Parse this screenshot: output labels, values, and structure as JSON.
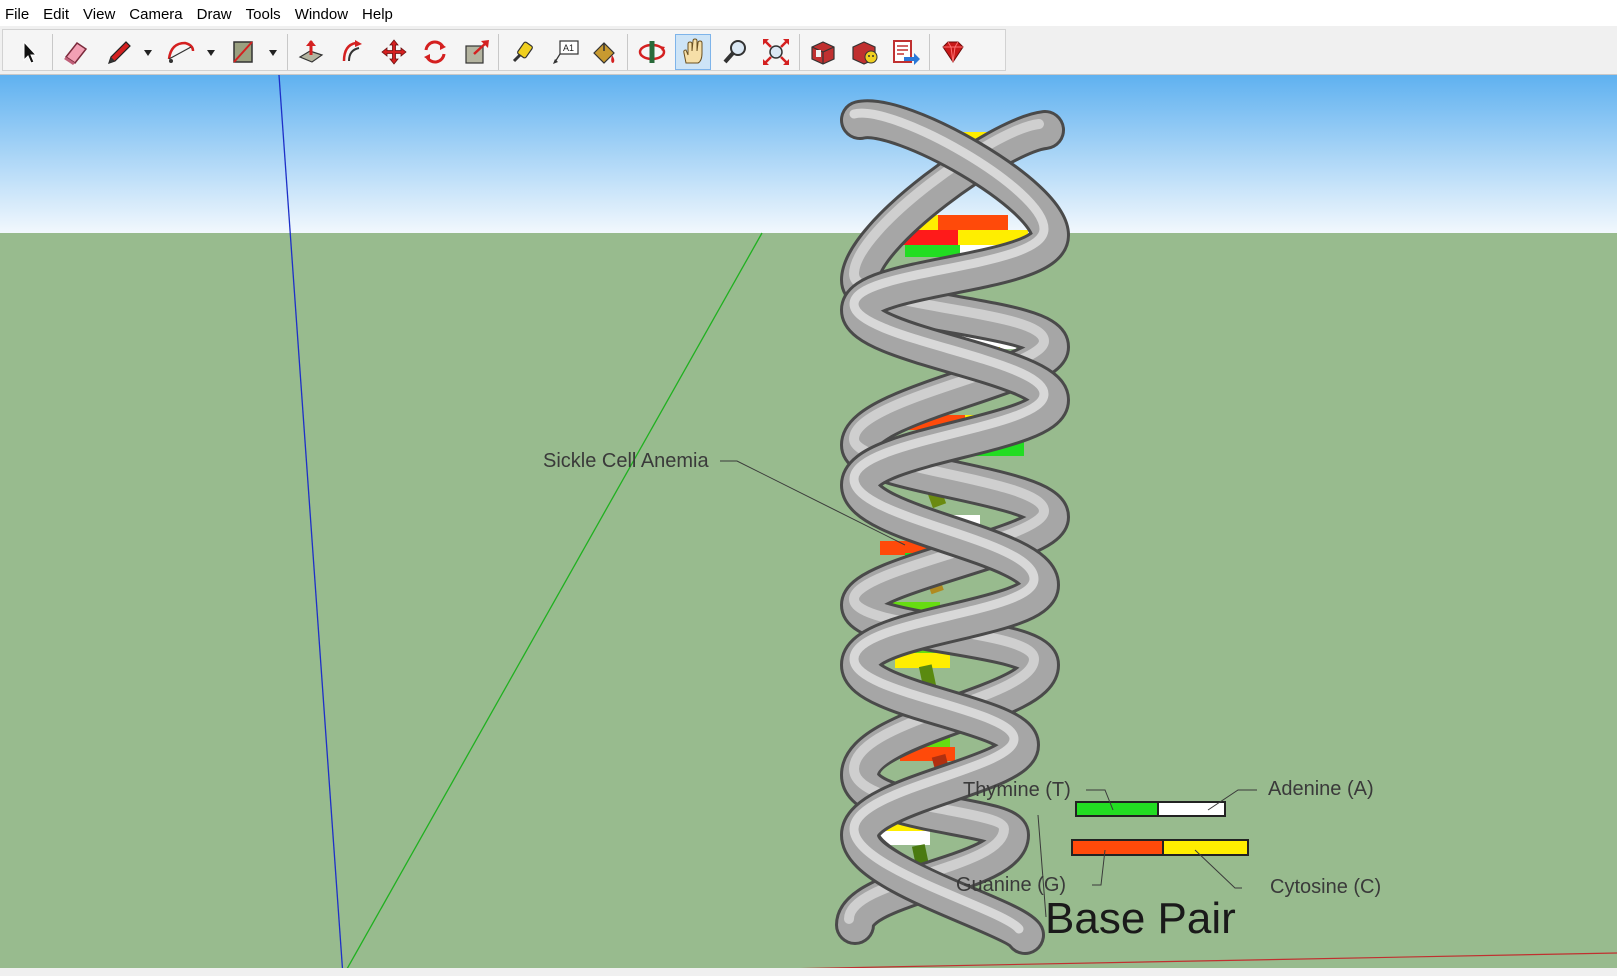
{
  "app": {
    "name": "SketchUp"
  },
  "menu": [
    "File",
    "Edit",
    "View",
    "Camera",
    "Draw",
    "Tools",
    "Window",
    "Help"
  ],
  "toolbar": {
    "tools": [
      {
        "name": "select-tool",
        "icon": "arrow-cursor-icon"
      },
      {
        "name": "eraser-tool",
        "icon": "eraser-icon"
      },
      {
        "name": "line-tool",
        "icon": "pencil-icon"
      },
      {
        "name": "arc-tool",
        "icon": "arc-icon"
      },
      {
        "name": "rectangle-tool",
        "icon": "rectangle-icon"
      },
      {
        "name": "push-pull-tool",
        "icon": "push-pull-icon"
      },
      {
        "name": "offset-tool",
        "icon": "offset-icon"
      },
      {
        "name": "move-tool",
        "icon": "move-icon"
      },
      {
        "name": "rotate-tool",
        "icon": "rotate-icon"
      },
      {
        "name": "scale-tool",
        "icon": "scale-icon"
      },
      {
        "name": "tape-measure-tool",
        "icon": "tape-measure-icon"
      },
      {
        "name": "text-tool",
        "icon": "text-label-icon"
      },
      {
        "name": "paint-bucket-tool",
        "icon": "paint-bucket-icon"
      },
      {
        "name": "orbit-tool",
        "icon": "orbit-icon"
      },
      {
        "name": "pan-tool",
        "icon": "hand-icon"
      },
      {
        "name": "zoom-tool",
        "icon": "magnifier-icon"
      },
      {
        "name": "zoom-extents-tool",
        "icon": "zoom-extents-icon"
      },
      {
        "name": "3d-warehouse-tool",
        "icon": "warehouse-icon"
      },
      {
        "name": "extension-warehouse-tool",
        "icon": "extension-icon"
      },
      {
        "name": "send-to-layout-tool",
        "icon": "layout-icon"
      },
      {
        "name": "ruby-console-tool",
        "icon": "ruby-gem-icon"
      }
    ],
    "active_tool": "pan-tool",
    "text_tool_glyph": "A1"
  },
  "scene": {
    "labels": {
      "sickle": "Sickle Cell Anemia",
      "thymine": "Thymine (T)",
      "adenine": "Adenine (A)",
      "guanine": "Guanine (G)",
      "cytosine": "Cytosine (C)",
      "base_pair": "Base Pair"
    },
    "colors": {
      "sky_top": "#5fb1f0",
      "sky_bottom": "#f2f8fd",
      "ground": "#98bb8e",
      "helix": "#a6a6a6",
      "thymine": "#22dd22",
      "adenine": "#ffffff",
      "guanine": "#ff4a0a",
      "cytosine": "#ffee00",
      "axis_blue": "#1d2fc8",
      "axis_green": "#20b020",
      "axis_red": "#c03030"
    }
  }
}
